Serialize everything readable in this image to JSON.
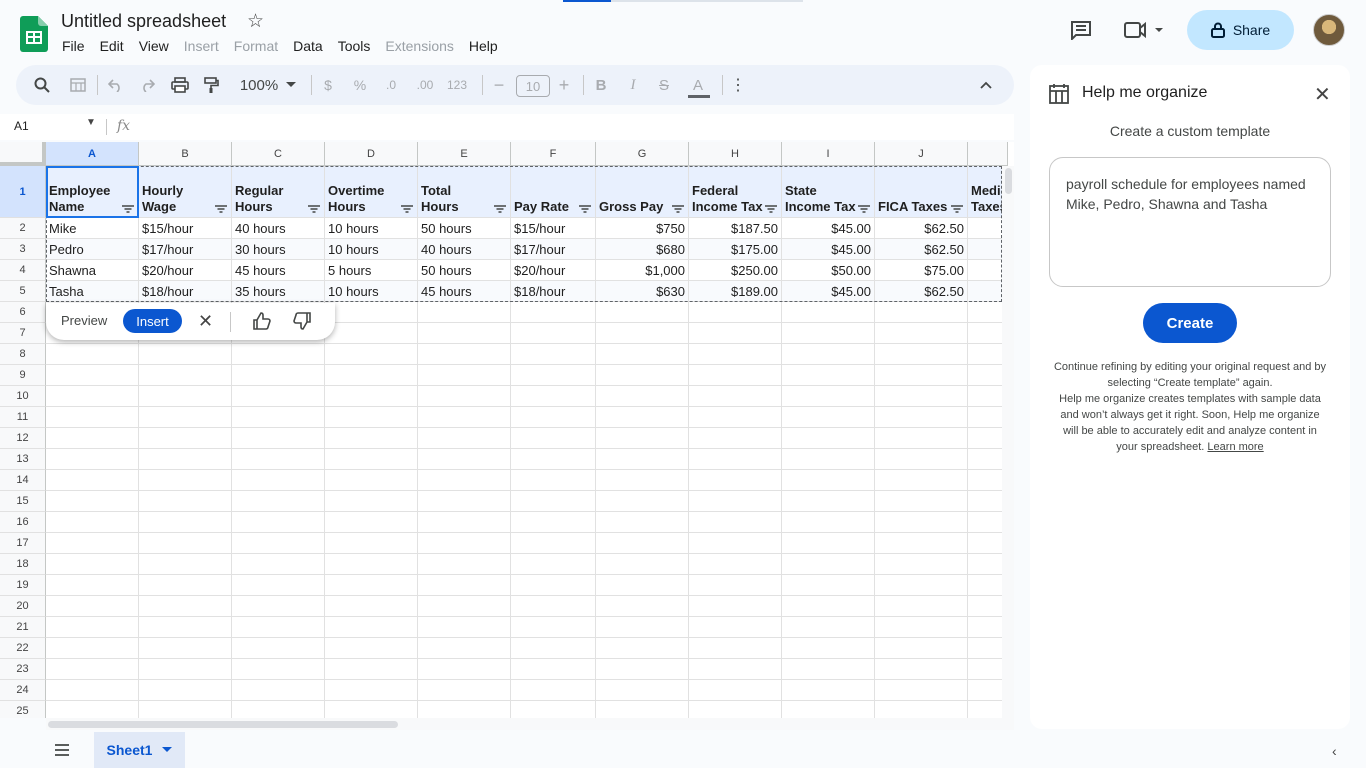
{
  "app": {
    "title": "Untitled spreadsheet",
    "menus": [
      {
        "label": "File",
        "enabled": true
      },
      {
        "label": "Edit",
        "enabled": true
      },
      {
        "label": "View",
        "enabled": true
      },
      {
        "label": "Insert",
        "enabled": false
      },
      {
        "label": "Format",
        "enabled": false
      },
      {
        "label": "Data",
        "enabled": true
      },
      {
        "label": "Tools",
        "enabled": true
      },
      {
        "label": "Extensions",
        "enabled": false
      },
      {
        "label": "Help",
        "enabled": true
      }
    ],
    "share_label": "Share"
  },
  "toolbar": {
    "zoom": "100%",
    "currency": "$",
    "percent": "%",
    "dec_less": ".0",
    "dec_more": ".00",
    "number_format": "123",
    "font_size": "10",
    "bold": "B",
    "italic": "I",
    "strike": "S",
    "text_color": "A",
    "more": "⋮"
  },
  "formula": {
    "cell_ref": "A1",
    "fx_label": "fx"
  },
  "grid": {
    "columns": [
      "A",
      "B",
      "C",
      "D",
      "E",
      "F",
      "G",
      "H",
      "I",
      "J",
      ""
    ],
    "row_numbers": [
      "1",
      "2",
      "3",
      "4",
      "5",
      "6",
      "7",
      "8",
      "9",
      "10",
      "11",
      "12",
      "13",
      "14",
      "15",
      "16",
      "17",
      "18",
      "19",
      "20",
      "21",
      "22",
      "23",
      "24",
      "25"
    ],
    "header_row": [
      "Employee Name",
      "Hourly Wage",
      "Regular Hours",
      "Overtime Hours",
      "Total Hours",
      "Pay Rate",
      "Gross Pay",
      "Federal Income Tax",
      "State Income Tax",
      "FICA Taxes",
      "Medi Taxes"
    ],
    "rows": [
      [
        "Mike",
        "$15/hour",
        "40 hours",
        "10 hours",
        "50 hours",
        "$15/hour",
        "$750",
        "$187.50",
        "$45.00",
        "$62.50",
        ""
      ],
      [
        "Pedro",
        "$17/hour",
        "30 hours",
        "10 hours",
        "40 hours",
        "$17/hour",
        "$680",
        "$175.00",
        "$45.00",
        "$62.50",
        ""
      ],
      [
        "Shawna",
        "$20/hour",
        "45 hours",
        "5 hours",
        "50 hours",
        "$20/hour",
        "$1,000",
        "$250.00",
        "$50.00",
        "$75.00",
        ""
      ],
      [
        "Tasha",
        "$18/hour",
        "35 hours",
        "10 hours",
        "45 hours",
        "$18/hour",
        "$630",
        "$189.00",
        "$45.00",
        "$62.50",
        ""
      ]
    ]
  },
  "ai_bar": {
    "preview_label": "Preview",
    "insert_label": "Insert"
  },
  "sheets": {
    "active": "Sheet1"
  },
  "panel": {
    "title": "Help me organize",
    "subtitle": "Create a custom template",
    "prompt_value": "payroll schedule for employees named Mike, Pedro, Shawna and Tasha",
    "create_label": "Create",
    "note_1": "Continue refining by editing your original request and by selecting “Create template” again.",
    "note_2": "Help me organize creates templates with sample data and won’t always get it right. Soon, Help me organize will be able to accurately edit and analyze content in your spreadsheet.",
    "learn_more": "Learn more"
  }
}
